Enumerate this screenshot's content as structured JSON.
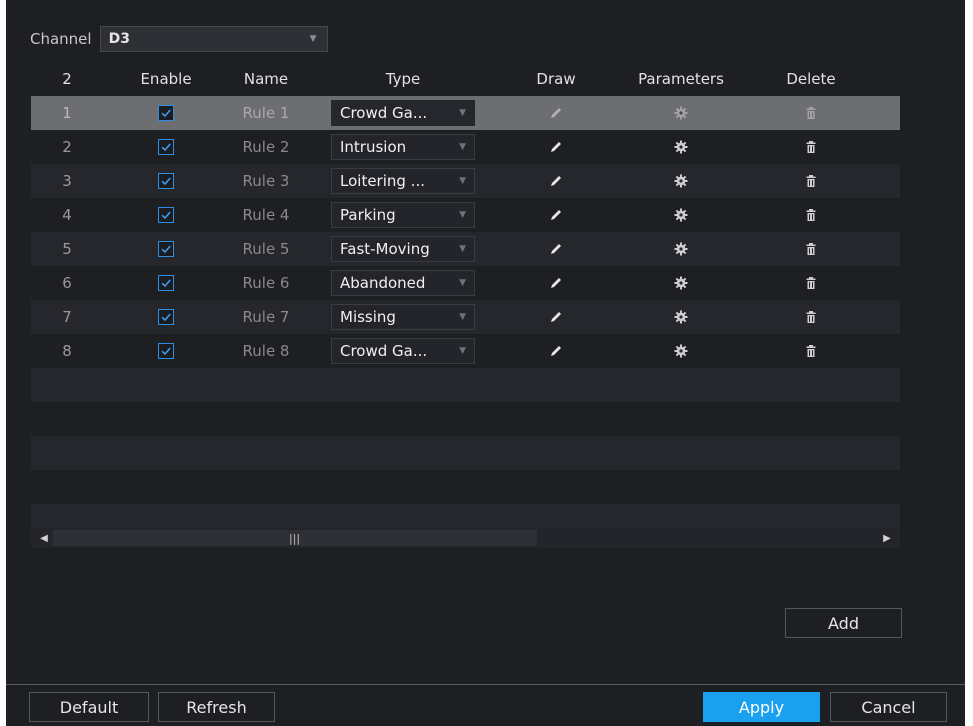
{
  "channel": {
    "label": "Channel",
    "value": "D3"
  },
  "table": {
    "headers": {
      "count": "2",
      "enable": "Enable",
      "name": "Name",
      "type": "Type",
      "draw": "Draw",
      "parameters": "Parameters",
      "delete": "Delete"
    },
    "rows": [
      {
        "index": "1",
        "enabled": true,
        "name": "Rule 1",
        "type": "Crowd Ga...",
        "selected": true
      },
      {
        "index": "2",
        "enabled": true,
        "name": "Rule 2",
        "type": "Intrusion"
      },
      {
        "index": "3",
        "enabled": true,
        "name": "Rule 3",
        "type": "Loitering ..."
      },
      {
        "index": "4",
        "enabled": true,
        "name": "Rule 4",
        "type": "Parking"
      },
      {
        "index": "5",
        "enabled": true,
        "name": "Rule 5",
        "type": "Fast-Moving"
      },
      {
        "index": "6",
        "enabled": true,
        "name": "Rule 6",
        "type": "Abandoned"
      },
      {
        "index": "7",
        "enabled": true,
        "name": "Rule 7",
        "type": "Missing"
      },
      {
        "index": "8",
        "enabled": true,
        "name": "Rule 8",
        "type": "Crowd Ga..."
      }
    ],
    "icons": {
      "draw": "pencil-icon",
      "parameters": "gear-icon",
      "delete": "trash-icon"
    }
  },
  "buttons": {
    "add": "Add",
    "default": "Default",
    "refresh": "Refresh",
    "apply": "Apply",
    "cancel": "Cancel"
  },
  "colors": {
    "background": "#1e1f23",
    "accent": "#1aa0ef",
    "selected_row": "#6d6e72",
    "checkbox_border": "#2f8fe0"
  }
}
